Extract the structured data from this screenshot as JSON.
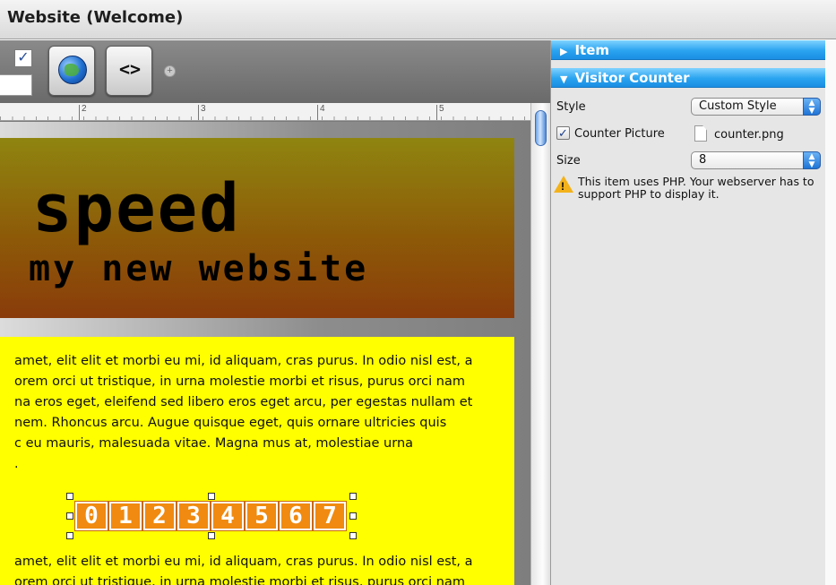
{
  "window": {
    "title": "Website (Welcome)"
  },
  "toolbar": {
    "checkbox_checked": true,
    "buttons": [
      {
        "name": "globe",
        "icon": "globe-icon"
      },
      {
        "name": "code",
        "icon": "code-icon",
        "glyph": "<>"
      }
    ],
    "add_glyph": "+"
  },
  "ruler": {
    "labels": [
      "2",
      "3",
      "4",
      "5"
    ]
  },
  "banner": {
    "headline": "speed",
    "subhead": "my new website"
  },
  "content": {
    "paragraph1": [
      "amet, elit elit et morbi eu mi, id aliquam, cras purus. In odio nisl est, a",
      "orem orci ut tristique, in urna molestie morbi et risus, purus orci nam",
      "na eros eget, eleifend sed libero eros eget arcu, per egestas nullam et",
      "nem. Rhoncus arcu. Augue quisque eget, quis ornare ultricies quis",
      "c eu mauris, malesuada vitae. Magna mus at, molestiae urna",
      "."
    ],
    "counter_digits": [
      "0",
      "1",
      "2",
      "3",
      "4",
      "5",
      "6",
      "7"
    ],
    "paragraph2": [
      "amet, elit elit et morbi eu mi, id aliquam, cras purus. In odio nisl est, a",
      "orem orci ut tristique, in urna molestie morbi et risus, purus orci nam"
    ]
  },
  "inspector": {
    "sections": [
      {
        "label": "Item",
        "expanded": false
      },
      {
        "label": "Visitor Counter",
        "expanded": true
      }
    ],
    "style_label": "Style",
    "style_value": "Custom Style",
    "counter_picture_label": "Counter Picture",
    "counter_picture_checked": true,
    "counter_picture_file": "counter.png",
    "size_label": "Size",
    "size_value": "8",
    "warning": "This item uses PHP. Your webserver has to support PHP to display it."
  },
  "colors": {
    "accent": "#2aa3f0",
    "counter_orange": "#f08a10",
    "content_yellow": "#ffff00",
    "banner_top": "#8f8510",
    "banner_bottom": "#8a3c0a"
  }
}
